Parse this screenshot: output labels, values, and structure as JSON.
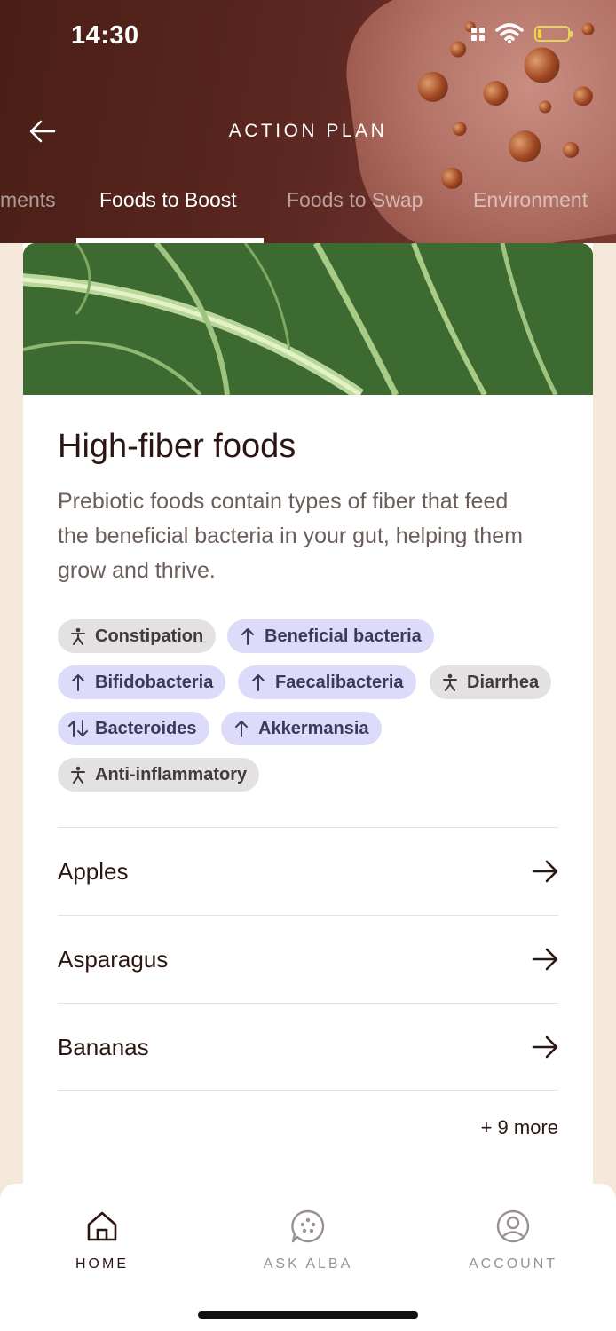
{
  "status": {
    "time": "14:30"
  },
  "header": {
    "title": "ACTION PLAN",
    "tabs": [
      {
        "label": "ments"
      },
      {
        "label": "Foods to Boost"
      },
      {
        "label": "Foods to Swap"
      },
      {
        "label": "Environment"
      }
    ],
    "active_tab": "Foods to Boost"
  },
  "card": {
    "title": "High-fiber foods",
    "description": "Prebiotic foods contain types of fiber that feed the beneficial bacteria in your gut, helping them grow and thrive.",
    "tags": [
      {
        "label": "Constipation",
        "icon": "person-icon",
        "style": "gray"
      },
      {
        "label": "Beneficial bacteria",
        "icon": "arrow-up-icon",
        "style": "blue"
      },
      {
        "label": "Bifidobacteria",
        "icon": "arrow-up-icon",
        "style": "blue"
      },
      {
        "label": "Faecalibacteria",
        "icon": "arrow-up-icon",
        "style": "blue"
      },
      {
        "label": "Diarrhea",
        "icon": "person-icon",
        "style": "gray"
      },
      {
        "label": "Bacteroides",
        "icon": "arrows-up-down-icon",
        "style": "blue"
      },
      {
        "label": "Akkermansia",
        "icon": "arrow-up-icon",
        "style": "blue"
      },
      {
        "label": "Anti-inflammatory",
        "icon": "person-icon",
        "style": "gray"
      }
    ],
    "foods": [
      {
        "label": "Apples"
      },
      {
        "label": "Asparagus"
      },
      {
        "label": "Bananas"
      }
    ],
    "more_label": "+ 9 more"
  },
  "nav": {
    "items": [
      {
        "label": "HOME",
        "icon": "home-icon"
      },
      {
        "label": "ASK ALBA",
        "icon": "chat-icon"
      },
      {
        "label": "ACCOUNT",
        "icon": "account-icon"
      }
    ],
    "active": "HOME"
  },
  "colors": {
    "header_bg": "#4a1e16",
    "accent_dark": "#2c1612",
    "tag_blue": "#dcdcfa",
    "tag_gray": "#e4e1e2",
    "page_bg": "#f4e8da"
  }
}
